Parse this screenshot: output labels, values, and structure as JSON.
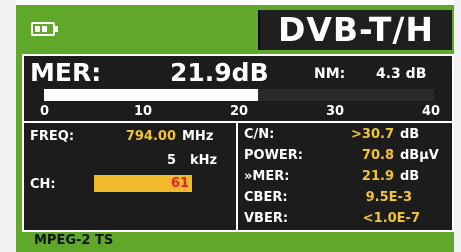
{
  "header": {
    "mode_title": "DVB-T/H",
    "battery_icon": "battery-icon"
  },
  "mer_panel": {
    "label": "MER:",
    "value": "21.9dB",
    "nm_label": "NM:",
    "nm_value": "4.3 dB",
    "scale_ticks": [
      "0",
      "10",
      "20",
      "30",
      "40"
    ],
    "bar_level_db": 21.9,
    "scale_max_db": 40
  },
  "tuning": {
    "freq_label": "FREQ:",
    "freq_value": "794.00",
    "freq_unit": "MHz",
    "step_value": "5",
    "step_unit": "kHz",
    "channel_label": "CH:",
    "channel_value": "61"
  },
  "measurements": [
    {
      "label": "C/N:",
      "value": ">30.7",
      "unit": "dB"
    },
    {
      "label": "POWER:",
      "value": "70.8",
      "unit": "dBµV"
    },
    {
      "label": "»MER:",
      "value": "21.9",
      "unit": "dB"
    },
    {
      "label": "CBER:",
      "value": "9.5E-3",
      "unit": ""
    },
    {
      "label": "VBER:",
      "value": "<1.0E-7",
      "unit": ""
    }
  ],
  "status_bar": {
    "stream_type": "MPEG-2 TS"
  },
  "colors": {
    "frame": "#5fa82a",
    "panel": "#1c1c1c",
    "value": "#f4c530",
    "channel_field": "#f2b92c",
    "channel_text": "#e5252a"
  }
}
